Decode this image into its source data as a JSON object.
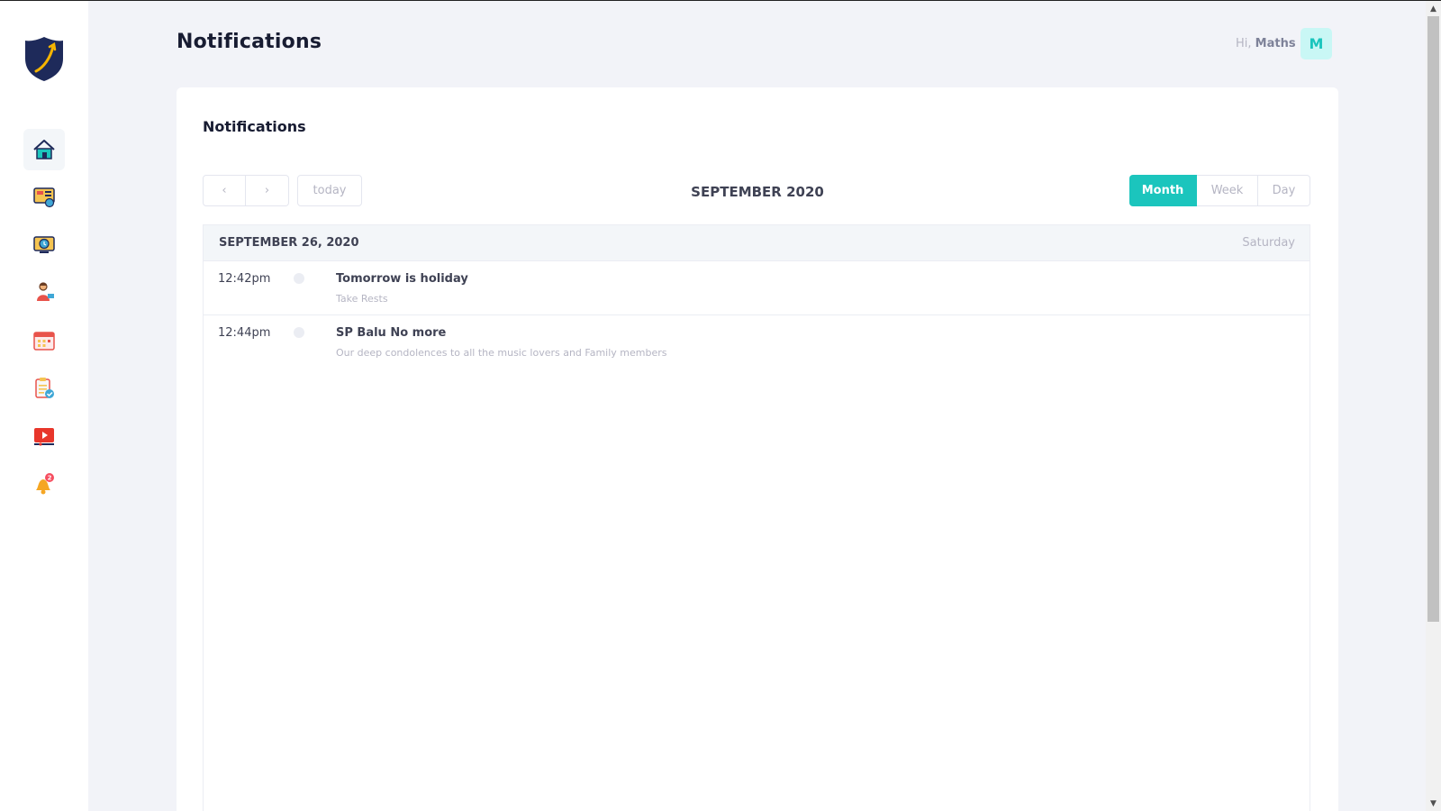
{
  "header": {
    "title": "Notifications",
    "greeting_prefix": "Hi,",
    "user_name": "Maths",
    "avatar_letter": "M"
  },
  "sidebar": {
    "items": [
      {
        "icon": "home-icon",
        "active": true
      },
      {
        "icon": "dashboard-report-icon",
        "active": false
      },
      {
        "icon": "monitor-clock-icon",
        "active": false
      },
      {
        "icon": "teacher-icon",
        "active": false
      },
      {
        "icon": "calendar-icon",
        "active": false
      },
      {
        "icon": "clipboard-check-icon",
        "active": false
      },
      {
        "icon": "video-play-icon",
        "active": false
      },
      {
        "icon": "bell-icon",
        "active": false,
        "badge": "2"
      }
    ]
  },
  "card": {
    "title": "Notifications",
    "toolbar": {
      "prev_label": "‹",
      "next_label": "›",
      "today_label": "today",
      "period_title": "SEPTEMBER 2020",
      "views": [
        "Month",
        "Week",
        "Day"
      ],
      "active_view": "Month"
    },
    "list": {
      "day_date": "SEPTEMBER 26, 2020",
      "day_name": "Saturday",
      "events": [
        {
          "time": "12:42pm",
          "title": "Tomorrow is holiday",
          "description": "Take Rests"
        },
        {
          "time": "12:44pm",
          "title": "SP Balu No more",
          "description": "Our deep condolences to all the music lovers and Family members"
        }
      ]
    }
  },
  "colors": {
    "accent": "#1bc5bd",
    "background": "#f2f3f8",
    "badge": "#f64e60"
  }
}
